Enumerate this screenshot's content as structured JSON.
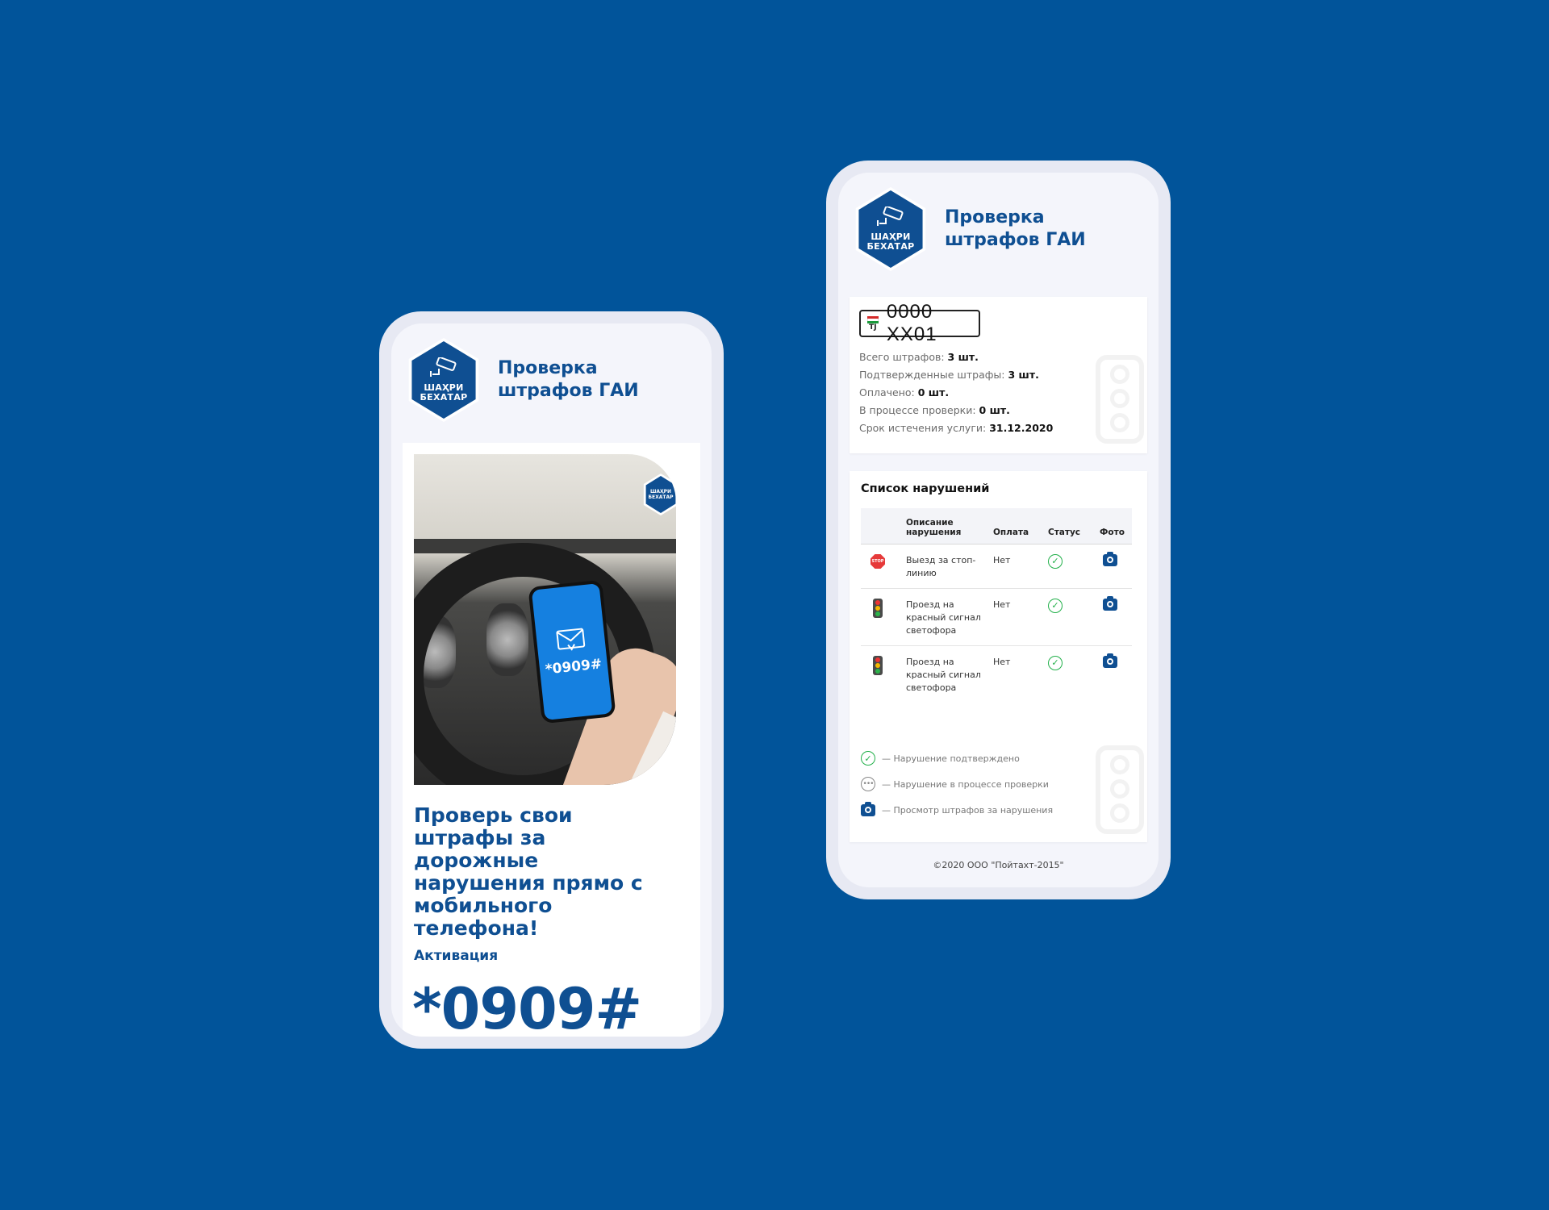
{
  "brand": {
    "logo_line1": "ШАҲРИ",
    "logo_line2": "БЕХАТАР",
    "title_line1": "Проверка",
    "title_line2": "штрафов ГАИ",
    "color": "#0f4f92"
  },
  "phone1": {
    "phone_screen_code": "*0909#",
    "promo_text": "Проверь свои штрафы за дорожные нарушения прямо с мобильного телефона!",
    "activation_label": "Активация",
    "activation_code": "*0909#"
  },
  "phone2": {
    "plate": {
      "country": "TJ",
      "number": "0000 XX01"
    },
    "stats": [
      {
        "label": "Всего штрафов: ",
        "value": "3 шт."
      },
      {
        "label": "Подтвержденные штрафы: ",
        "value": "3 шт."
      },
      {
        "label": "Оплачено: ",
        "value": "0 шт."
      },
      {
        "label": "В процессе проверки: ",
        "value": "0 шт."
      },
      {
        "label": "Срок истечения услуги: ",
        "value": "31.12.2020"
      }
    ],
    "list_title": "Список нарушений",
    "columns": [
      "Описание нарушения",
      "Оплата",
      "Статус",
      "Фото"
    ],
    "violations": [
      {
        "icon": "stop-sign-icon",
        "description": "Выезд за стоп-линию",
        "payment": "Нет",
        "status": "confirmed"
      },
      {
        "icon": "traffic-light-icon",
        "description": "Проезд на красный сигнал светофора",
        "payment": "Нет",
        "status": "confirmed"
      },
      {
        "icon": "traffic-light-icon",
        "description": "Проезд на красный сигнал светофора",
        "payment": "Нет",
        "status": "confirmed"
      }
    ],
    "legend": [
      {
        "icon": "check-circle-icon",
        "text": "— Нарушение подтверждено"
      },
      {
        "icon": "dots-circle-icon",
        "text": "— Нарушение в процессе проверки"
      },
      {
        "icon": "camera-icon",
        "text": "— Просмотр штрафов за нарушения"
      }
    ],
    "footer": "©2020 ООО \"Пойтахт-2015\""
  }
}
